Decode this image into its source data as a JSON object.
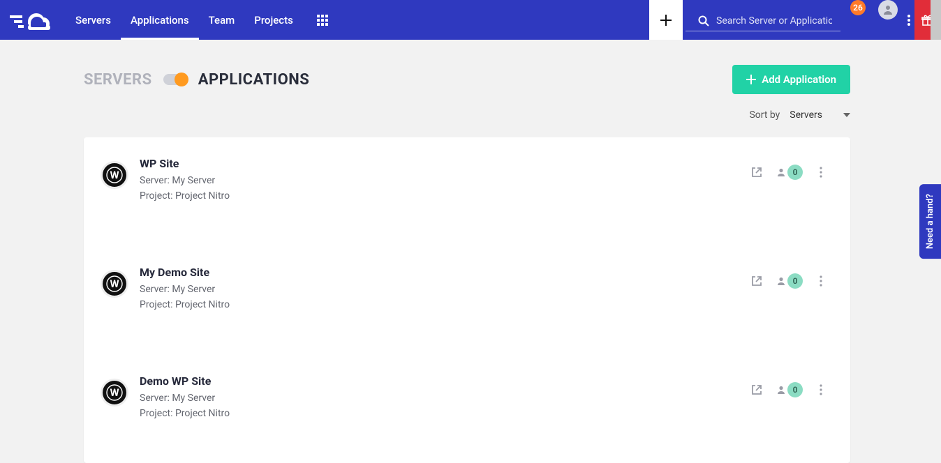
{
  "nav": {
    "items": [
      "Servers",
      "Applications",
      "Team",
      "Projects"
    ],
    "active_index": 1
  },
  "search": {
    "placeholder": "Search Server or Application",
    "notification_count": "26"
  },
  "page_header": {
    "left_label": "SERVERS",
    "right_label": "APPLICATIONS",
    "add_button": "Add Application"
  },
  "sort": {
    "label": "Sort by",
    "value": "Servers"
  },
  "apps": [
    {
      "name": "WP Site",
      "server_line": "Server: My Server",
      "project_line": "Project: Project Nitro",
      "team_count": "0"
    },
    {
      "name": "My Demo Site",
      "server_line": "Server: My Server",
      "project_line": "Project: Project Nitro",
      "team_count": "0"
    },
    {
      "name": "Demo WP Site",
      "server_line": "Server: My Server",
      "project_line": "Project: Project Nitro",
      "team_count": "0"
    }
  ],
  "help_tab": "Need a hand?"
}
